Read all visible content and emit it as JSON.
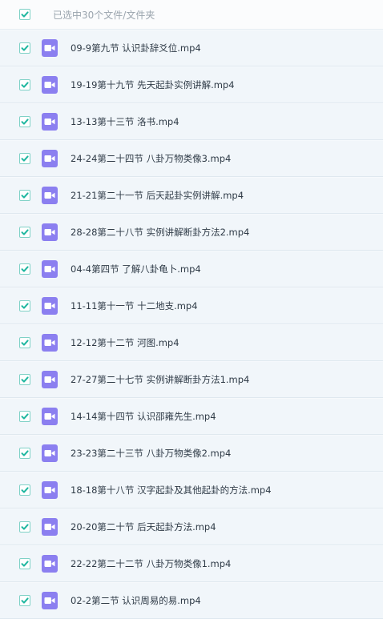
{
  "header": {
    "label": "已选中30个文件/文件夹"
  },
  "files": [
    "09-9第九节 认识卦辞爻位.mp4",
    "19-19第十九节 先天起卦实例讲解.mp4",
    "13-13第十三节 洛书.mp4",
    "24-24第二十四节 八卦万物类像3.mp4",
    "21-21第二十一节 后天起卦实例讲解.mp4",
    "28-28第二十八节 实例讲解断卦方法2.mp4",
    "04-4第四节 了解八卦龟卜.mp4",
    "11-11第十一节 十二地支.mp4",
    "12-12第十二节 河图.mp4",
    "27-27第二十七节 实例讲解断卦方法1.mp4",
    "14-14第十四节 认识邵雍先生.mp4",
    "23-23第二十三节 八卦万物类像2.mp4",
    "18-18第十八节 汉字起卦及其他起卦的方法.mp4",
    "20-20第二十节 后天起卦方法.mp4",
    "22-22第二十二节 八卦万物类像1.mp4",
    "02-2第二节 认识周易的易.mp4"
  ],
  "colors": {
    "check": "#1fb7a0",
    "video_icon": "#8b7ff0"
  }
}
